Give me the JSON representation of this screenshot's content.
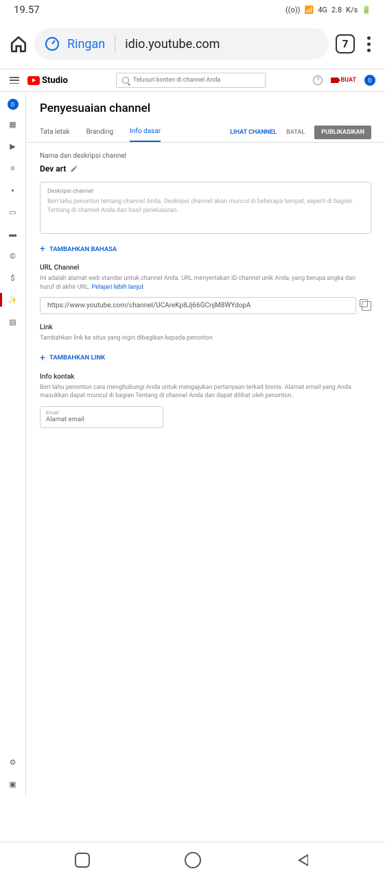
{
  "status": {
    "time": "19.57",
    "net": "4G",
    "speed": "2.8",
    "speed_unit": "K/s",
    "hotspot": "((o))"
  },
  "browser": {
    "speed_label": "Ringan",
    "url": "idio.youtube.com",
    "tab_count": "7"
  },
  "header": {
    "logo_text": "Studio",
    "search_placeholder": "Telusuri konten di channel Anda",
    "create": "BUAT",
    "avatar": "D",
    "help": "?"
  },
  "sidebar": {
    "avatar": "D"
  },
  "page": {
    "title": "Penyesuaian channel",
    "tabs": [
      {
        "label": "Tata letak"
      },
      {
        "label": "Branding"
      },
      {
        "label": "Info dasar"
      }
    ],
    "actions": {
      "view": "LIHAT CHANNEL",
      "cancel": "BATAL",
      "publish": "PUBLIKASIKAN"
    },
    "name_section": {
      "label": "Nama dan deskripsi channel",
      "name": "Dev art"
    },
    "desc_box": {
      "label": "Deskripsi channel",
      "placeholder": "Beri tahu penonton tentang channel Anda. Deskripsi channel akan muncul di beberapa tempat, seperti di bagian Tentang di channel Anda dan hasil penelusuran."
    },
    "add_lang": "TAMBAHKAN BAHASA",
    "url_section": {
      "title": "URL Channel",
      "desc": "Ini adalah alamat web standar untuk channel Anda. URL menyertakan ID channel unik Anda, yang berupa angka dan huruf di akhir URL.",
      "learn": "Pelajari lebih lanjut",
      "value": "https://www.youtube.com/channel/UCAreKp8Jj66GCnjM8WYdopA"
    },
    "link_section": {
      "title": "Link",
      "desc": "Tambahkan link ke situs yang ingin dibagikan kepada penonton",
      "add": "TAMBAHKAN LINK"
    },
    "contact_section": {
      "title": "Info kontak",
      "desc": "Beri tahu penonton cara menghubungi Anda untuk mengajukan pertanyaan terkait bisnis. Alamat email yang Anda masukkan dapat muncul di bagian Tentang di channel Anda dan dapat dilihat oleh penonton.",
      "email_label": "Email",
      "email_placeholder": "Alamat email"
    }
  }
}
